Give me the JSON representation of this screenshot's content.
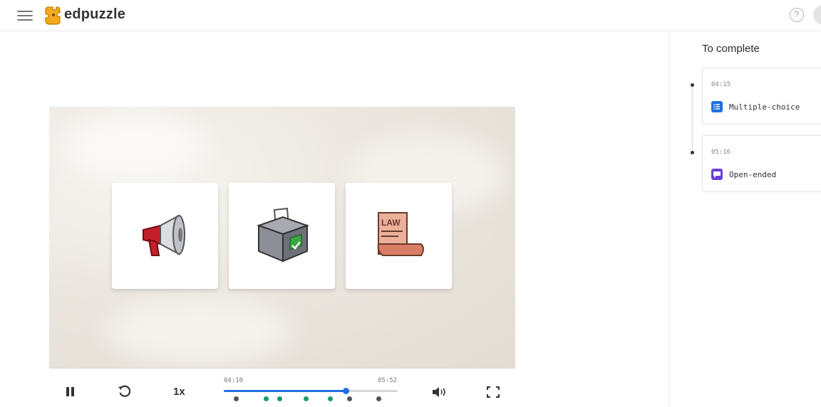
{
  "header": {
    "logo_text": "edpuzzle",
    "help_symbol": "?",
    "menu_icon": "hamburger-icon",
    "avatar_icon": "user-avatar"
  },
  "video": {
    "cards": [
      {
        "icon": "megaphone-icon"
      },
      {
        "icon": "ballot-box-icon"
      },
      {
        "icon": "law-scroll-icon",
        "text": "LAW"
      }
    ]
  },
  "controls": {
    "play_pause_icon": "pause-icon",
    "rewind_icon": "rewind-icon",
    "speed": "1x",
    "time_start": "04:10",
    "time_end": "05:52",
    "progress": 0.7,
    "volume_icon": "volume-icon",
    "fullscreen_icon": "fullscreen-icon",
    "question_markers": [
      {
        "position": 0.07,
        "status": "unanswered"
      },
      {
        "position": 0.24,
        "status": "answered"
      },
      {
        "position": 0.32,
        "status": "answered"
      },
      {
        "position": 0.47,
        "status": "answered"
      },
      {
        "position": 0.61,
        "status": "answered"
      },
      {
        "position": 0.72,
        "status": "unanswered"
      },
      {
        "position": 0.89,
        "status": "unanswered"
      }
    ],
    "colors": {
      "progress": "#1f6fe0",
      "answered": "#1a9b6c",
      "unanswered": "#555555"
    }
  },
  "sidebar": {
    "title": "To complete",
    "questions": [
      {
        "time": "04:15",
        "type": "Multiple-choice",
        "icon": "list-icon",
        "color": "#1f6fe0"
      },
      {
        "time": "05:16",
        "type": "Open-ended",
        "icon": "chat-bubble-icon",
        "color": "#6a3fd8"
      }
    ]
  }
}
